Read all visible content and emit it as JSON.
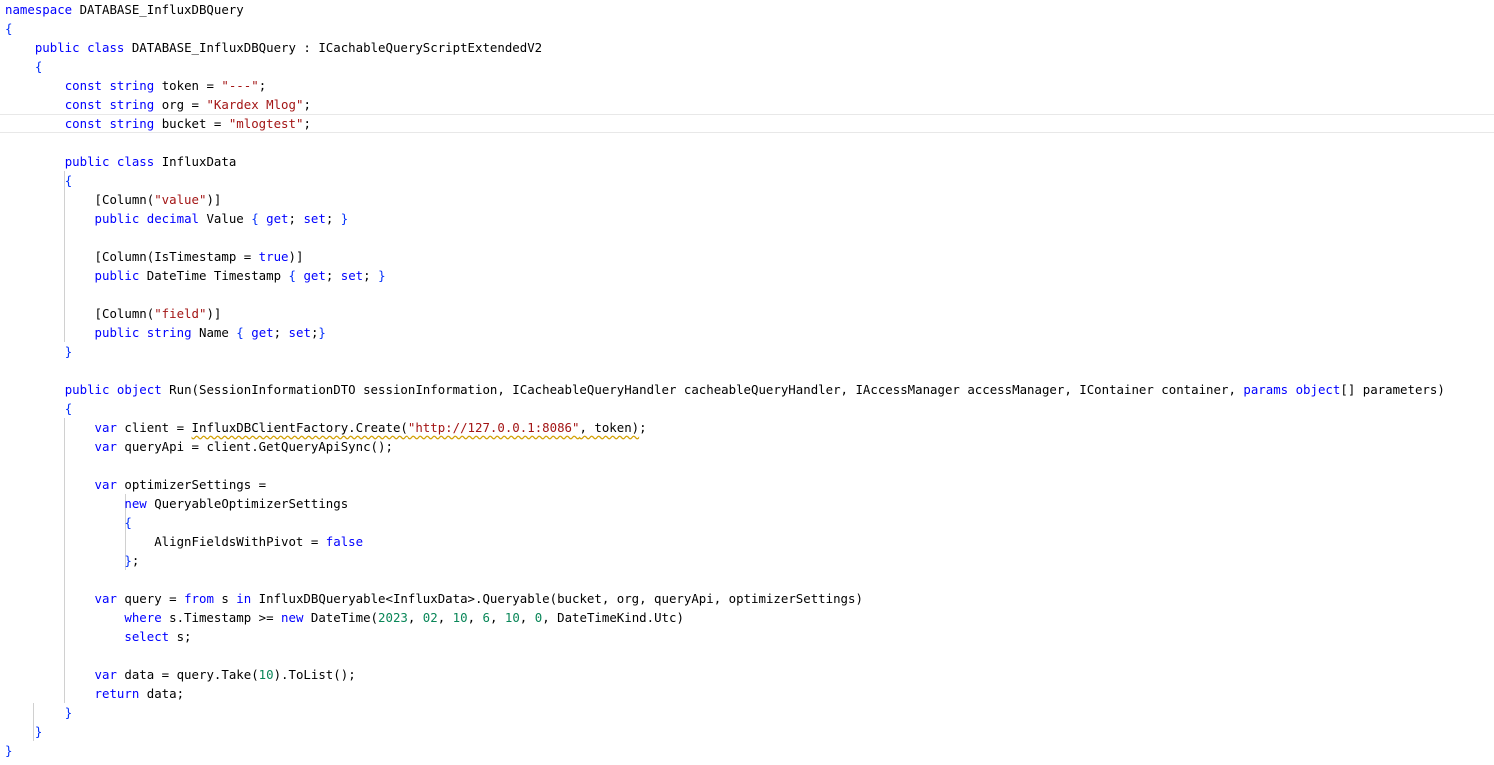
{
  "code_lines": [
    [
      {
        "t": "namespace",
        "c": "kw"
      },
      {
        "t": " DATABASE_InfluxDBQuery"
      }
    ],
    [
      {
        "t": "{",
        "c": "brace"
      }
    ],
    [
      {
        "t": "    "
      },
      {
        "t": "public",
        "c": "kw"
      },
      {
        "t": " "
      },
      {
        "t": "class",
        "c": "kw"
      },
      {
        "t": " DATABASE_InfluxDBQuery : ICachableQueryScriptExtendedV2"
      }
    ],
    [
      {
        "t": "    "
      },
      {
        "t": "{",
        "c": "brace"
      }
    ],
    [
      {
        "t": "        "
      },
      {
        "t": "const",
        "c": "kw"
      },
      {
        "t": " "
      },
      {
        "t": "string",
        "c": "kw"
      },
      {
        "t": " token = "
      },
      {
        "t": "\"---\"",
        "c": "str"
      },
      {
        "t": ";"
      }
    ],
    [
      {
        "t": "        "
      },
      {
        "t": "const",
        "c": "kw"
      },
      {
        "t": " "
      },
      {
        "t": "string",
        "c": "kw"
      },
      {
        "t": " org = "
      },
      {
        "t": "\"Kardex Mlog\"",
        "c": "str"
      },
      {
        "t": ";"
      }
    ],
    [
      {
        "t": "        "
      },
      {
        "t": "const",
        "c": "kw"
      },
      {
        "t": " "
      },
      {
        "t": "string",
        "c": "kw"
      },
      {
        "t": " bucket = "
      },
      {
        "t": "\"mlogtest\"",
        "c": "str"
      },
      {
        "t": ";"
      }
    ],
    [],
    [
      {
        "t": "        "
      },
      {
        "t": "public",
        "c": "kw"
      },
      {
        "t": " "
      },
      {
        "t": "class",
        "c": "kw"
      },
      {
        "t": " InfluxData"
      }
    ],
    [
      {
        "t": "        "
      },
      {
        "t": "{",
        "c": "brace"
      }
    ],
    [
      {
        "t": "            "
      },
      {
        "t": "["
      },
      {
        "t": "Column("
      },
      {
        "t": "\"value\"",
        "c": "str"
      },
      {
        "t": ")"
      },
      {
        "t": "]"
      }
    ],
    [
      {
        "t": "            "
      },
      {
        "t": "public",
        "c": "kw"
      },
      {
        "t": " "
      },
      {
        "t": "decimal",
        "c": "kw"
      },
      {
        "t": " Value "
      },
      {
        "t": "{",
        "c": "brace"
      },
      {
        "t": " "
      },
      {
        "t": "get",
        "c": "kw"
      },
      {
        "t": "; "
      },
      {
        "t": "set",
        "c": "kw"
      },
      {
        "t": "; "
      },
      {
        "t": "}",
        "c": "brace"
      }
    ],
    [],
    [
      {
        "t": "            "
      },
      {
        "t": "["
      },
      {
        "t": "Column(IsTimestamp = "
      },
      {
        "t": "true",
        "c": "kw"
      },
      {
        "t": ")"
      },
      {
        "t": "]"
      }
    ],
    [
      {
        "t": "            "
      },
      {
        "t": "public",
        "c": "kw"
      },
      {
        "t": " DateTime Timestamp "
      },
      {
        "t": "{",
        "c": "brace"
      },
      {
        "t": " "
      },
      {
        "t": "get",
        "c": "kw"
      },
      {
        "t": "; "
      },
      {
        "t": "set",
        "c": "kw"
      },
      {
        "t": "; "
      },
      {
        "t": "}",
        "c": "brace"
      }
    ],
    [],
    [
      {
        "t": "            "
      },
      {
        "t": "["
      },
      {
        "t": "Column("
      },
      {
        "t": "\"field\"",
        "c": "str"
      },
      {
        "t": ")"
      },
      {
        "t": "]"
      }
    ],
    [
      {
        "t": "            "
      },
      {
        "t": "public",
        "c": "kw"
      },
      {
        "t": " "
      },
      {
        "t": "string",
        "c": "kw"
      },
      {
        "t": " Name "
      },
      {
        "t": "{",
        "c": "brace"
      },
      {
        "t": " "
      },
      {
        "t": "get",
        "c": "kw"
      },
      {
        "t": "; "
      },
      {
        "t": "set",
        "c": "kw"
      },
      {
        "t": ";"
      },
      {
        "t": "}",
        "c": "brace"
      }
    ],
    [
      {
        "t": "        "
      },
      {
        "t": "}",
        "c": "brace"
      }
    ],
    [],
    [
      {
        "t": "        "
      },
      {
        "t": "public",
        "c": "kw"
      },
      {
        "t": " "
      },
      {
        "t": "object",
        "c": "kw"
      },
      {
        "t": " Run(SessionInformationDTO sessionInformation, ICacheableQueryHandler cacheableQueryHandler, IAccessManager accessManager, IContainer container, "
      },
      {
        "t": "params",
        "c": "kw"
      },
      {
        "t": " "
      },
      {
        "t": "object",
        "c": "kw"
      },
      {
        "t": "[] parameters)"
      }
    ],
    [
      {
        "t": "        "
      },
      {
        "t": "{",
        "c": "brace"
      }
    ],
    [
      {
        "t": "            "
      },
      {
        "t": "var",
        "c": "kw"
      },
      {
        "t": " client = "
      },
      {
        "t": "InfluxDBClientFactory.Create(",
        "c": "squiggle"
      },
      {
        "t": "\"http://127.0.0.1:8086\"",
        "c": "str squiggle"
      },
      {
        "t": ", token)",
        "c": "squiggle"
      },
      {
        "t": ";"
      }
    ],
    [
      {
        "t": "            "
      },
      {
        "t": "var",
        "c": "kw"
      },
      {
        "t": " queryApi = client.GetQueryApiSync();"
      }
    ],
    [],
    [
      {
        "t": "            "
      },
      {
        "t": "var",
        "c": "kw"
      },
      {
        "t": " optimizerSettings ="
      }
    ],
    [
      {
        "t": "                "
      },
      {
        "t": "new",
        "c": "kw"
      },
      {
        "t": " QueryableOptimizerSettings"
      }
    ],
    [
      {
        "t": "                "
      },
      {
        "t": "{",
        "c": "brace"
      }
    ],
    [
      {
        "t": "                    AlignFieldsWithPivot = "
      },
      {
        "t": "false",
        "c": "kw"
      }
    ],
    [
      {
        "t": "                "
      },
      {
        "t": "}",
        "c": "brace"
      },
      {
        "t": ";"
      }
    ],
    [],
    [
      {
        "t": "            "
      },
      {
        "t": "var",
        "c": "kw"
      },
      {
        "t": " query = "
      },
      {
        "t": "from",
        "c": "kw"
      },
      {
        "t": " s "
      },
      {
        "t": "in",
        "c": "kw"
      },
      {
        "t": " InfluxDBQueryable<InfluxData>.Queryable(bucket, org, queryApi, optimizerSettings)"
      }
    ],
    [
      {
        "t": "                "
      },
      {
        "t": "where",
        "c": "kw"
      },
      {
        "t": " s.Timestamp >= "
      },
      {
        "t": "new",
        "c": "kw"
      },
      {
        "t": " DateTime("
      },
      {
        "t": "2023",
        "c": "num"
      },
      {
        "t": ", "
      },
      {
        "t": "02",
        "c": "num"
      },
      {
        "t": ", "
      },
      {
        "t": "10",
        "c": "num"
      },
      {
        "t": ", "
      },
      {
        "t": "6",
        "c": "num"
      },
      {
        "t": ", "
      },
      {
        "t": "10",
        "c": "num"
      },
      {
        "t": ", "
      },
      {
        "t": "0",
        "c": "num"
      },
      {
        "t": ", DateTimeKind.Utc)"
      }
    ],
    [
      {
        "t": "                "
      },
      {
        "t": "select",
        "c": "kw"
      },
      {
        "t": " s;"
      }
    ],
    [],
    [
      {
        "t": "            "
      },
      {
        "t": "var",
        "c": "kw"
      },
      {
        "t": " data = query.Take("
      },
      {
        "t": "10",
        "c": "num"
      },
      {
        "t": ").ToList();"
      }
    ],
    [
      {
        "t": "            "
      },
      {
        "t": "return",
        "c": "kw"
      },
      {
        "t": " data;"
      }
    ],
    [
      {
        "t": "        "
      },
      {
        "t": "}",
        "c": "brace"
      }
    ],
    [
      {
        "t": "    "
      },
      {
        "t": "}",
        "c": "brace"
      }
    ],
    [
      {
        "t": "}",
        "c": "brace"
      }
    ]
  ],
  "current_line": 6
}
